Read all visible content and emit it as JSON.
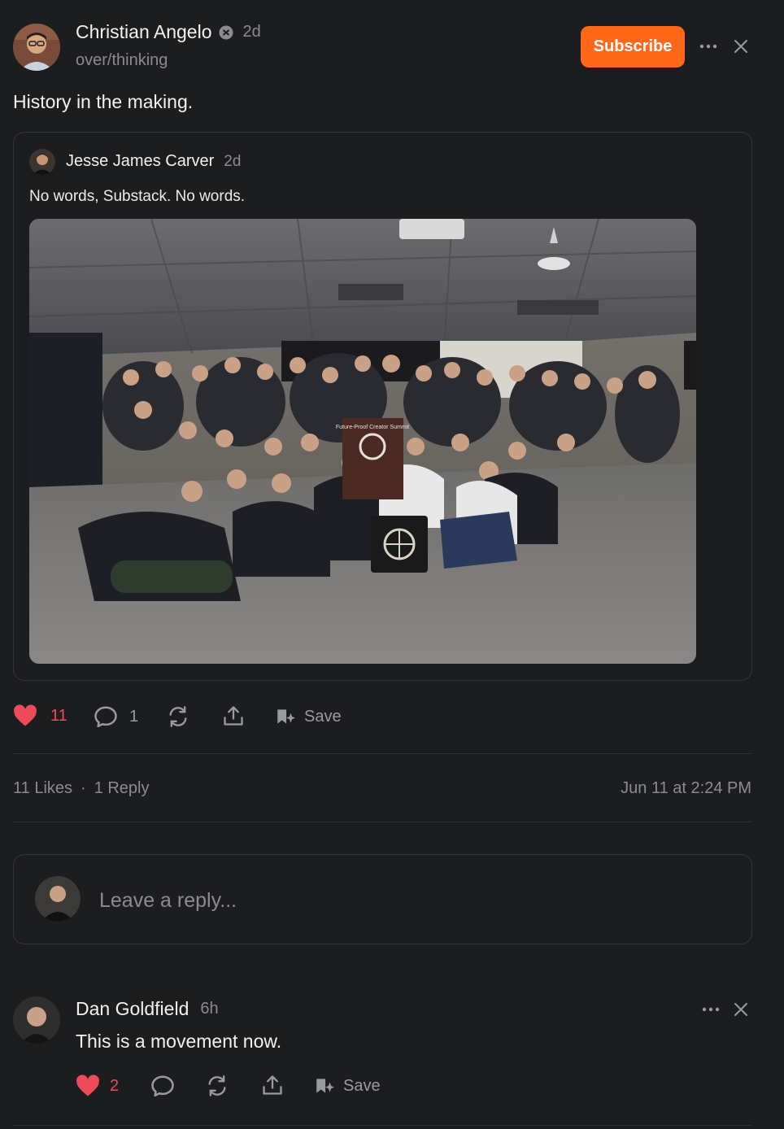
{
  "post": {
    "author": "Christian Angelo",
    "time": "2d",
    "publication": "over/thinking",
    "subscribe_label": "Subscribe",
    "text": "History in the making.",
    "likes": "11",
    "replies": "1",
    "save_label": "Save",
    "likes_summary": "11 Likes",
    "replies_summary": "1 Reply",
    "dot": "·",
    "date": "Jun 11 at 2:24 PM"
  },
  "quoted": {
    "author": "Jesse James Carver",
    "time": "2d",
    "text": "No words, Substack. No words.",
    "image_alt": "Group photo of event attendees",
    "podium_text": "Future-Proof Creator Summit"
  },
  "reply_box": {
    "placeholder": "Leave a reply..."
  },
  "comment": {
    "author": "Dan Goldfield",
    "time": "6h",
    "text": "This is a movement now.",
    "likes": "2",
    "save_label": "Save"
  },
  "colors": {
    "background": "#1c1d1f",
    "accent": "#ff6719",
    "like": "#ee4a5a",
    "muted": "#8b8c90"
  }
}
